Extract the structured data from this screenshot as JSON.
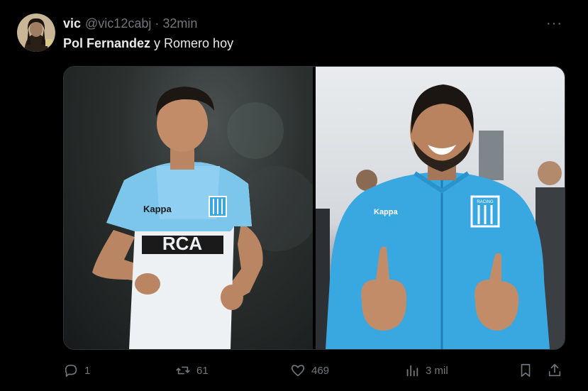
{
  "tweet": {
    "display_name": "vic",
    "handle": "@vic12cabj",
    "separator": "·",
    "time_ago": "32min",
    "text_bold": "Pol Fernandez",
    "text_rest": " y Romero hoy",
    "more_label": "···"
  },
  "actions": {
    "replies": "1",
    "retweets": "61",
    "likes": "469",
    "views": "3 mil"
  },
  "photos": {
    "left": {
      "jersey_brand": "Kappa",
      "sponsor": "RCA"
    },
    "right": {
      "jacket_brand": "Kappa",
      "crest_text": "RACING"
    }
  },
  "colors": {
    "background": "#000000",
    "text_primary": "#e7e9ea",
    "text_secondary": "#71767b",
    "racing_sky_blue": "#3aa8e0"
  },
  "icons": [
    "avatar",
    "more-icon",
    "reply-icon",
    "retweet-icon",
    "like-icon",
    "views-icon",
    "bookmark-icon",
    "share-icon"
  ]
}
